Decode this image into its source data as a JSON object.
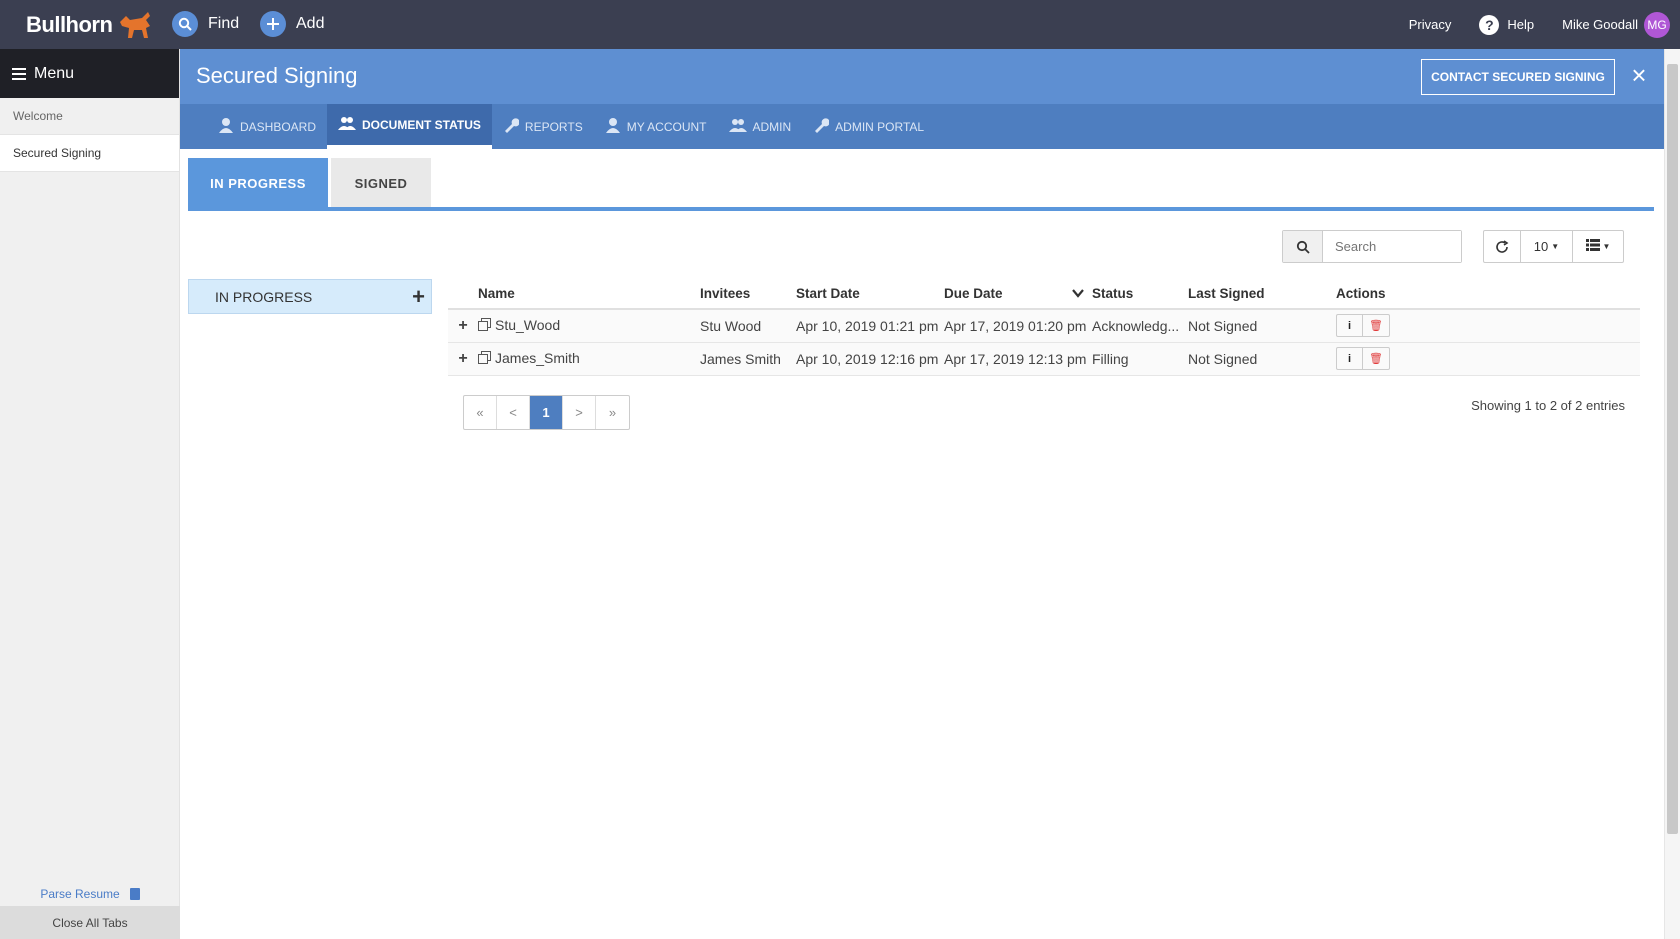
{
  "app": {
    "logo_text": "Bullhorn",
    "find": "Find",
    "add": "Add",
    "privacy": "Privacy",
    "help": "Help",
    "user_name": "Mike Goodall",
    "user_initials": "MG"
  },
  "sidebar": {
    "menu_label": "Menu",
    "items": [
      {
        "label": "Welcome"
      },
      {
        "label": "Secured Signing"
      }
    ],
    "parse_resume": "Parse Resume",
    "close_all": "Close All Tabs"
  },
  "header": {
    "title": "Secured Signing",
    "contact_button": "CONTACT SECURED SIGNING"
  },
  "nav": {
    "tabs": [
      {
        "label": "DASHBOARD"
      },
      {
        "label": "DOCUMENT STATUS"
      },
      {
        "label": "REPORTS"
      },
      {
        "label": "MY ACCOUNT"
      },
      {
        "label": "ADMIN"
      },
      {
        "label": "ADMIN PORTAL"
      }
    ]
  },
  "subtabs": [
    {
      "label": "IN PROGRESS"
    },
    {
      "label": "SIGNED"
    }
  ],
  "search": {
    "placeholder": "Search"
  },
  "toolbar": {
    "page_size": "10"
  },
  "filter": {
    "label": "IN PROGRESS"
  },
  "table": {
    "columns": [
      "Name",
      "Invitees",
      "Start Date",
      "Due Date",
      "Status",
      "Last Signed",
      "Actions"
    ],
    "rows": [
      {
        "name": "Stu_Wood",
        "invitees": "Stu Wood",
        "start": "Apr 10, 2019 01:21 pm",
        "due": "Apr 17, 2019 01:20 pm",
        "status": "Acknowledg...",
        "last_signed": "Not Signed"
      },
      {
        "name": "James_Smith",
        "invitees": "James Smith",
        "start": "Apr 10, 2019 12:16 pm",
        "due": "Apr 17, 2019 12:13 pm",
        "status": "Filling",
        "last_signed": "Not Signed"
      }
    ]
  },
  "pager": {
    "first": "«",
    "prev": "<",
    "current": "1",
    "next": ">",
    "last": "»"
  },
  "showing": "Showing 1 to 2 of 2 entries"
}
